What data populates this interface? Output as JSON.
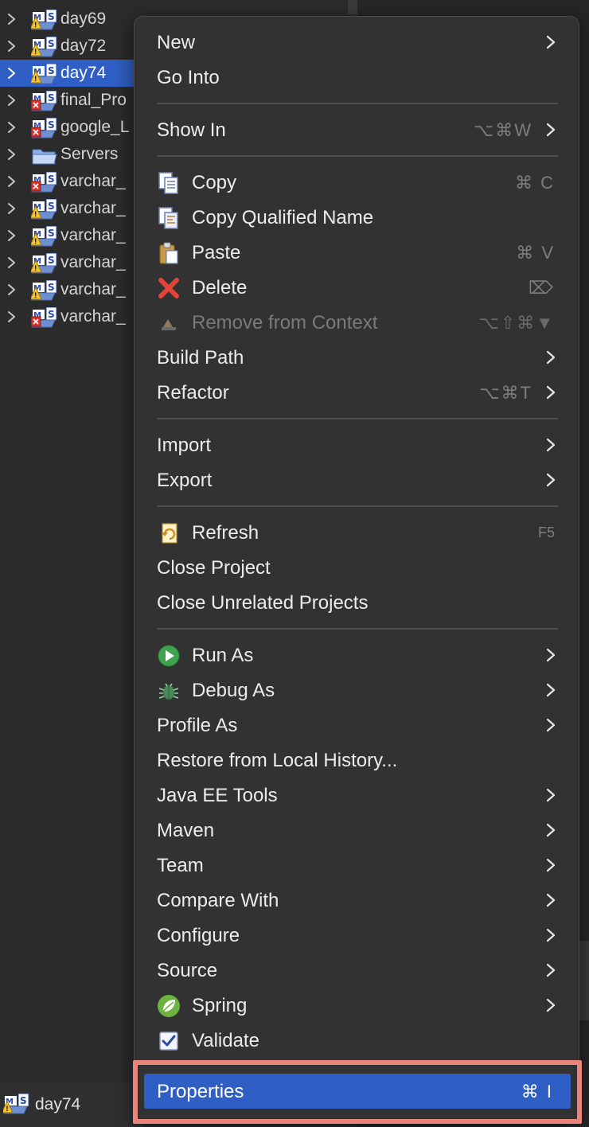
{
  "tree": {
    "items": [
      {
        "label": "day69",
        "icon": "maven-project-warning-icon",
        "selected": false
      },
      {
        "label": "day72",
        "icon": "maven-project-warning-icon",
        "selected": false
      },
      {
        "label": "day74",
        "icon": "maven-project-warning-icon",
        "selected": true
      },
      {
        "label": "final_Pro",
        "icon": "maven-project-error-icon",
        "selected": false
      },
      {
        "label": "google_L",
        "icon": "maven-project-error-icon",
        "selected": false
      },
      {
        "label": "Servers",
        "icon": "folder-icon",
        "selected": false
      },
      {
        "label": "varchar_",
        "icon": "maven-project-error-icon",
        "selected": false
      },
      {
        "label": "varchar_",
        "icon": "maven-project-warning-icon",
        "selected": false
      },
      {
        "label": "varchar_",
        "icon": "maven-project-warning-icon",
        "selected": false
      },
      {
        "label": "varchar_",
        "icon": "maven-project-warning-icon",
        "selected": false
      },
      {
        "label": "varchar_",
        "icon": "maven-project-warning-icon",
        "selected": false
      },
      {
        "label": "varchar_",
        "icon": "maven-project-error-icon",
        "selected": false
      }
    ]
  },
  "status": {
    "label": "day74"
  },
  "menu": {
    "new": "New",
    "go_into": "Go Into",
    "show_in": "Show In",
    "show_in_shortcut": "⌥⌘W",
    "copy": "Copy",
    "copy_shortcut": "⌘ C",
    "copy_qualified_name": "Copy Qualified Name",
    "paste": "Paste",
    "paste_shortcut": "⌘ V",
    "delete": "Delete",
    "delete_shortcut": "⌦",
    "remove_from_context": "Remove from Context",
    "remove_shortcut": "⌥⇧⌘▼",
    "build_path": "Build Path",
    "refactor": "Refactor",
    "refactor_shortcut": "⌥⌘T",
    "import": "Import",
    "export": "Export",
    "refresh": "Refresh",
    "refresh_shortcut": "F5",
    "close_project": "Close Project",
    "close_unrelated": "Close Unrelated Projects",
    "run_as": "Run As",
    "debug_as": "Debug As",
    "profile_as": "Profile As",
    "restore_history": "Restore from Local History...",
    "java_ee_tools": "Java EE Tools",
    "maven": "Maven",
    "team": "Team",
    "compare_with": "Compare With",
    "configure": "Configure",
    "source": "Source",
    "spring": "Spring",
    "validate": "Validate",
    "properties": "Properties",
    "properties_shortcut": "⌘ I"
  },
  "colors": {
    "selection": "#2f5fc4",
    "menu_bg": "#323232",
    "callout": "#e8847a"
  }
}
